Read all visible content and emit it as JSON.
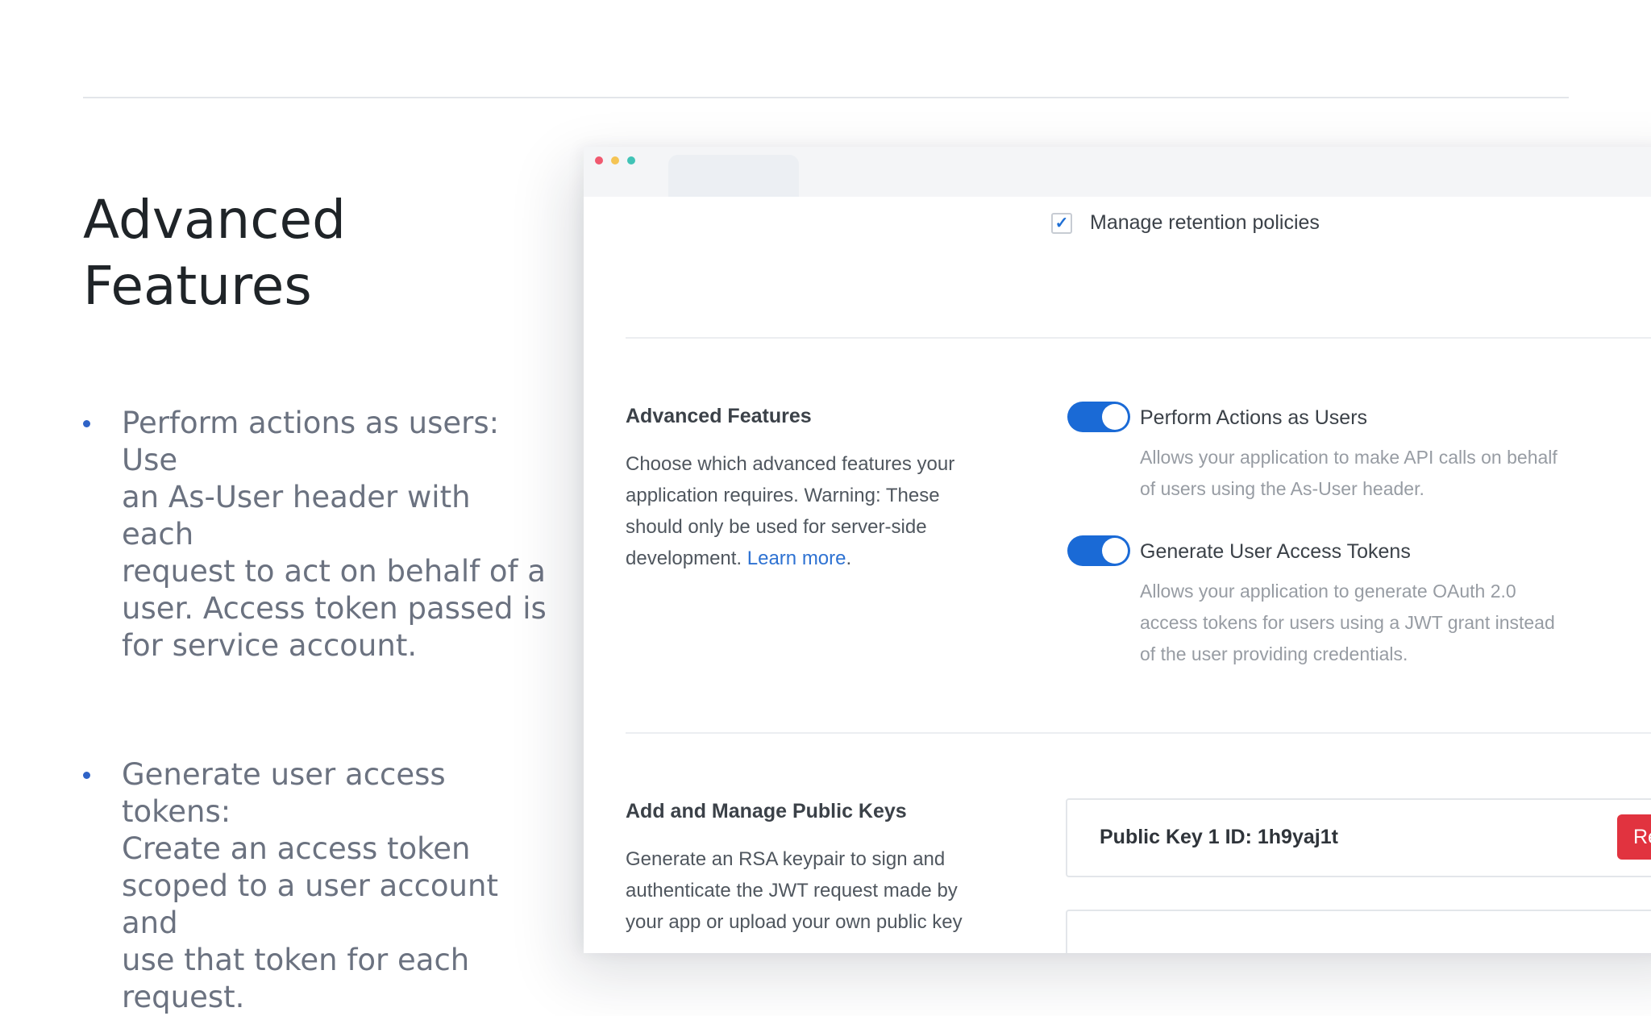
{
  "slide": {
    "title_lines": [
      "Advanced",
      "Features"
    ],
    "bullets": [
      {
        "lines": [
          "Perform actions as users: Use",
          "an As-User header with each",
          "request to act on behalf of a",
          "user. Access token passed is",
          "for service account."
        ]
      },
      {
        "lines": [
          "Generate user access tokens:",
          "Create an access token",
          "scoped to a user account and",
          "use that token for each",
          "request."
        ]
      }
    ]
  },
  "screenshot": {
    "window_dots": [
      "#f0596f",
      "#f5c454",
      "#41c3b6"
    ],
    "retention_checkbox": {
      "label": "Manage retention policies",
      "checked": true
    },
    "advanced": {
      "title": "Advanced Features",
      "desc_lines": [
        "Choose which advanced features your",
        "application requires. Warning: These",
        "should only be used for server-side"
      ],
      "desc_last": "development.",
      "learn_more": "Learn more",
      "options": [
        {
          "label": "Perform Actions as Users",
          "enabled": true,
          "desc_lines": [
            "Allows your application to make API calls on behalf",
            "of users using the As-User header."
          ]
        },
        {
          "label": "Generate User Access Tokens",
          "enabled": true,
          "desc_lines": [
            "Allows your application to generate OAuth 2.0",
            "access tokens for users using a JWT grant instead",
            "of the user providing credentials."
          ]
        }
      ]
    },
    "keys": {
      "title": "Add and Manage Public Keys",
      "desc_lines": [
        "Generate an RSA keypair to sign and",
        "authenticate the JWT request made by",
        "your app or upload your own public key"
      ],
      "public_key_label": "Public Key 1 ID: 1h9yaj1t",
      "button_label": "Re"
    }
  },
  "colors": {
    "accent": "#1a6ad6",
    "link": "#2e72d2",
    "danger": "#e1333f",
    "bullet": "#2f63c7"
  }
}
